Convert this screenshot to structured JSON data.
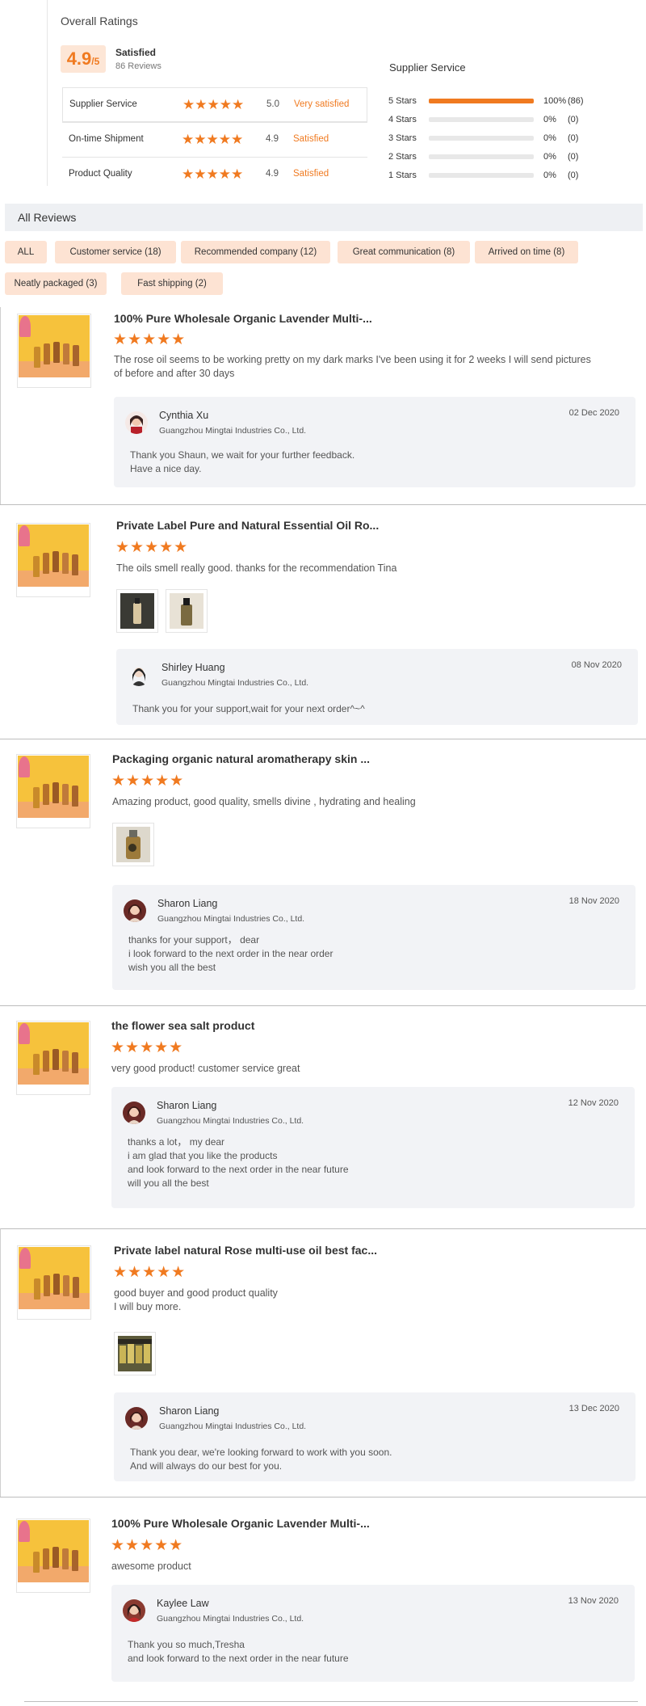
{
  "overall": {
    "title": "Overall Ratings",
    "score": "4.9",
    "score_suffix": "/5",
    "status": "Satisfied",
    "reviews_count": "86 Reviews",
    "details": [
      {
        "label": "Supplier Service",
        "stars": "★★★★★",
        "score": "5.0",
        "text": "Very satisfied"
      },
      {
        "label": "On-time Shipment",
        "stars": "★★★★★",
        "score": "4.9",
        "text": "Satisfied"
      },
      {
        "label": "Product Quality",
        "stars": "★★★★★",
        "score": "4.9",
        "text": "Satisfied"
      }
    ]
  },
  "supplier_service": {
    "title": "Supplier Service",
    "rows": [
      {
        "label": "5 Stars",
        "percent": "100%",
        "count": "(86)",
        "fraction": 1.0
      },
      {
        "label": "4 Stars",
        "percent": "0%",
        "count": "(0)",
        "fraction": 0
      },
      {
        "label": "3 Stars",
        "percent": "0%",
        "count": "(0)",
        "fraction": 0
      },
      {
        "label": "2 Stars",
        "percent": "0%",
        "count": "(0)",
        "fraction": 0
      },
      {
        "label": "1 Stars",
        "percent": "0%",
        "count": "(0)",
        "fraction": 0
      }
    ]
  },
  "all_reviews": {
    "title": "All Reviews",
    "tags": [
      "ALL",
      "Customer service (18)",
      "Recommended company (12)",
      "Great communication (8)",
      "Arrived on time (8)",
      "Neatly packaged (3)",
      "Fast shipping (2)"
    ]
  },
  "reviews": [
    {
      "title": "100% Pure Wholesale Organic Lavender Multi-...",
      "stars": "★★★★★",
      "text": "The rose oil seems to be working pretty on my dark marks I've been using it for 2 weeks I will send pictures\nof before and after 30 days",
      "reply": {
        "name": "Cynthia Xu",
        "company": "Guangzhou Mingtai Industries Co., Ltd.",
        "date": "02 Dec 2020",
        "text": "Thank you Shaun, we wait for your further feedback.\nHave a nice day."
      }
    },
    {
      "title": "Private Label Pure and Natural Essential Oil Ro...",
      "stars": "★★★★★",
      "text": "The oils smell really good. thanks for the recommendation Tina",
      "reply": {
        "name": "Shirley Huang",
        "company": "Guangzhou Mingtai Industries Co., Ltd.",
        "date": "08 Nov 2020",
        "text": "Thank you for your support,wait for your next order^~^"
      }
    },
    {
      "title": "Packaging organic natural aromatherapy skin ...",
      "stars": "★★★★★",
      "text": "Amazing product, good quality, smells divine , hydrating and healing",
      "reply": {
        "name": "Sharon Liang",
        "company": "Guangzhou Mingtai Industries Co., Ltd.",
        "date": "18 Nov 2020",
        "text": "thanks for your support， dear\ni look forward to the next order in the near order\nwish you all the best"
      }
    },
    {
      "title": "the flower sea salt product",
      "stars": "★★★★★",
      "text": "very good product! customer service great",
      "reply": {
        "name": "Sharon Liang",
        "company": "Guangzhou Mingtai Industries Co., Ltd.",
        "date": "12 Nov 2020",
        "text": "thanks a lot， my dear\ni am glad that you like the products\nand look forward to the next order in the near future\nwill you all the best"
      }
    },
    {
      "title": "Private label natural Rose multi-use oil best fac...",
      "stars": "★★★★★",
      "text": "good buyer and good product quality\nI will buy more.",
      "reply": {
        "name": "Sharon Liang",
        "company": "Guangzhou Mingtai Industries Co., Ltd.",
        "date": "13 Dec 2020",
        "text": "Thank you dear, we're looking forward to work with you soon.\nAnd will always do our best for you."
      }
    },
    {
      "title": "100% Pure Wholesale Organic Lavender Multi-...",
      "stars": "★★★★★",
      "text": "awesome product",
      "reply": {
        "name": "Kaylee Law",
        "company": "Guangzhou Mingtai Industries Co., Ltd.",
        "date": "13 Nov 2020",
        "text": "Thank you so much,Tresha\nand look forward to the next order in the near future"
      }
    }
  ]
}
